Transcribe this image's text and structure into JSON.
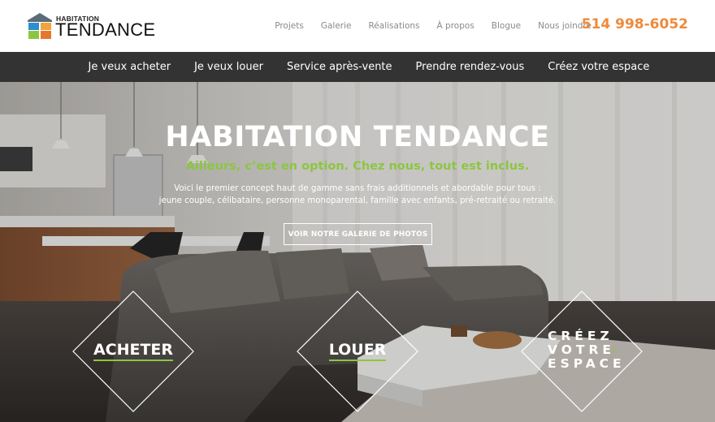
{
  "brand": {
    "name_top": "HABITATION",
    "name_main": "TENDANCE",
    "colors": {
      "accent_orange": "#ef8a3a",
      "accent_green": "#8cc63f",
      "nav_bg": "#333333"
    }
  },
  "top_nav": {
    "items": [
      "Projets",
      "Galerie",
      "Réalisations",
      "À propos",
      "Blogue",
      "Nous joindre"
    ],
    "phone": "514 998-6052"
  },
  "main_nav": {
    "items": [
      "Je veux acheter",
      "Je veux louer",
      "Service après-vente",
      "Prendre rendez-vous",
      "Créez votre espace"
    ]
  },
  "hero": {
    "title": "HABITATION TENDANCE",
    "tagline": "Ailleurs, c’est en option. Chez nous, tout est inclus.",
    "desc_line1": "Voici le premier concept haut de gamme sans frais additionnels et abordable pour tous :",
    "desc_line2": "jeune couple, célibataire, personne monoparental, famille avec enfants, pré-retraité ou retraité.",
    "gallery_button": "VOIR NOTRE GALERIE DE PHOTOS"
  },
  "tiles": {
    "acheter": "ACHETER",
    "louer": "LOUER",
    "creez_line1": "CRÉEZ",
    "creez_line2": "VOTRE",
    "creez_line3": "ESPACE",
    "arrow_icon": "chevron-right-icon"
  }
}
